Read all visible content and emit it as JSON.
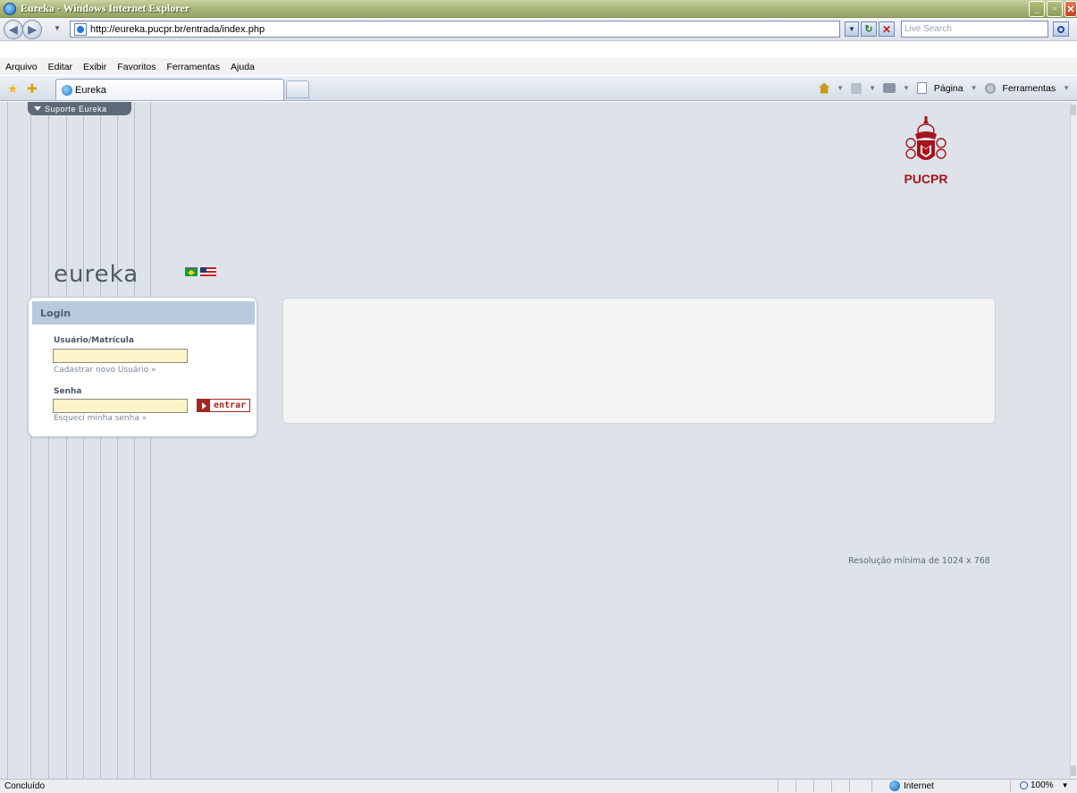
{
  "window": {
    "title": "Eureka - Windows Internet Explorer"
  },
  "address": {
    "url": "http://eureka.pucpr.br/entrada/index.php",
    "search_placeholder": "Live Search"
  },
  "menu": {
    "items": [
      "Arquivo",
      "Editar",
      "Exibir",
      "Favoritos",
      "Ferramentas",
      "Ajuda"
    ]
  },
  "tabs": {
    "active_label": "Eureka"
  },
  "commandbar": {
    "page_label": "Página",
    "tools_label": "Ferramentas"
  },
  "page": {
    "support_tab": "Suporte Eureka",
    "brand": "PUCPR",
    "app_logo": "eureka",
    "login": {
      "header": "Login",
      "user_label": "Usuário/Matrícula",
      "user_value": "",
      "register_link": "Cadastrar novo Usuário »",
      "password_label": "Senha",
      "password_value": "",
      "forgot_link": "Esqueci minha senha »",
      "submit_label": "entrar"
    },
    "resolution_note": "Resolução mínima de 1024 x 768"
  },
  "statusbar": {
    "status": "Concluído",
    "zone": "Internet",
    "zoom": "100%"
  },
  "colors": {
    "page_bg": "#dee3ea",
    "login_header": "#b9cadd",
    "brand_red": "#a8131b",
    "input_bg": "#fbf5c9"
  },
  "icons": [
    "ie-logo-icon",
    "back-icon",
    "forward-icon",
    "page-icon",
    "refresh-icon",
    "stop-icon",
    "search-icon",
    "favorites-star-icon",
    "add-favorites-icon",
    "home-icon",
    "feeds-icon",
    "print-icon",
    "page-menu-icon",
    "tools-menu-icon",
    "globe-icon",
    "zoom-icon",
    "brazil-flag-icon",
    "us-flag-icon",
    "pucpr-crest-icon",
    "enter-arrow-icon"
  ]
}
